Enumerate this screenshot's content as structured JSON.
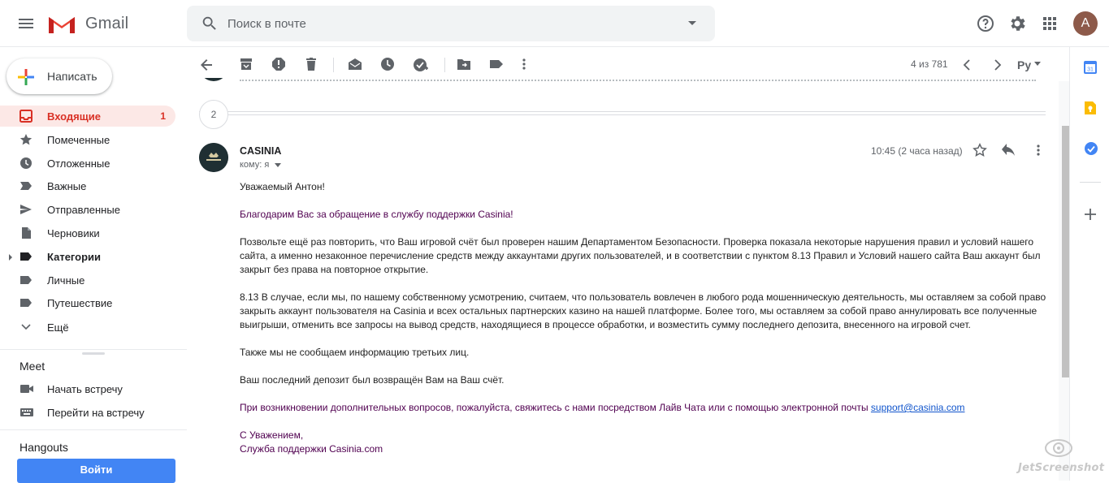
{
  "header": {
    "app_name": "Gmail",
    "search_placeholder": "Поиск в почте",
    "avatar_letter": "A"
  },
  "sidebar": {
    "compose_label": "Написать",
    "items": [
      {
        "label": "Входящие",
        "icon": "inbox-icon",
        "count": "1",
        "active": true
      },
      {
        "label": "Помеченные",
        "icon": "star-icon"
      },
      {
        "label": "Отложенные",
        "icon": "clock-icon"
      },
      {
        "label": "Важные",
        "icon": "label-important-icon"
      },
      {
        "label": "Отправленные",
        "icon": "send-icon"
      },
      {
        "label": "Черновики",
        "icon": "draft-icon"
      },
      {
        "label": "Категории",
        "icon": "label-icon",
        "bold": true
      },
      {
        "label": "Личные",
        "icon": "label-icon"
      },
      {
        "label": "Путешествие",
        "icon": "label-icon"
      },
      {
        "label": "Ещё",
        "icon": "chevron-down-icon"
      }
    ],
    "meet": {
      "title": "Meet",
      "items": [
        {
          "label": "Начать встречу",
          "icon": "videocam-icon"
        },
        {
          "label": "Перейти на встречу",
          "icon": "keyboard-icon"
        }
      ]
    },
    "hangouts": {
      "title": "Hangouts",
      "join_label": "Войти"
    }
  },
  "toolbar": {
    "pager": "4 из 781",
    "language": "Ру"
  },
  "thread": {
    "collapsed_count": "2",
    "message": {
      "sender": "CASINIA",
      "to": "кому: я",
      "time": "10:45 (2 часа назад)",
      "body": {
        "greeting": "Уважаемый Антон!",
        "thanks": "Благодарим Вас за обращение в службу поддержки Casinia!",
        "p1": "Позвольте ещё раз повторить, что Ваш игровой счёт был проверен нашим Департаментом Безопасности. Проверка показала некоторые нарушения правил и условий нашего сайта, а именно незаконное перечисление средств между аккаунтами других пользователей, и в соответствии с пунктом 8.13 Правил и Условий нашего сайта Ваш аккаунт был закрыт без права на повторное открытие.",
        "p2": "8.13 В случае, если мы, по нашему собственному усмотрению, считаем, что пользователь вовлечен в любого рода мошенническую деятельность, мы оставляем за собой право закрыть аккаунт пользователя на Casinia и всех остальных партнерских казино на нашей платформе. Более того, мы оставляем за собой право аннулировать все полученные выигрыши, отменить все запросы на вывод средств, находящиеся в процессе обработки, и возместить сумму последнего депозита, внесенного на игровой счет.",
        "p3": "Также мы не сообщаем информацию третьих лиц.",
        "p4": "Ваш последний депозит был возвращён Вам на Ваш счёт.",
        "p5_text": "При возникновении дополнительных вопросов, пожалуйста, свяжитесь с нами посредством Лайв Чата или с помощью электронной почты",
        "p5_link": "support@casinia.com",
        "sign1": "С Уважением,",
        "sign2": "Служба поддержки Casinia.com"
      }
    }
  },
  "watermark": "JetScreenshot",
  "colors": {
    "accent_red": "#d93025",
    "active_bg": "#fce8e6",
    "link": "#1155cc",
    "purple_text": "#500050",
    "button_blue": "#4285f4"
  }
}
